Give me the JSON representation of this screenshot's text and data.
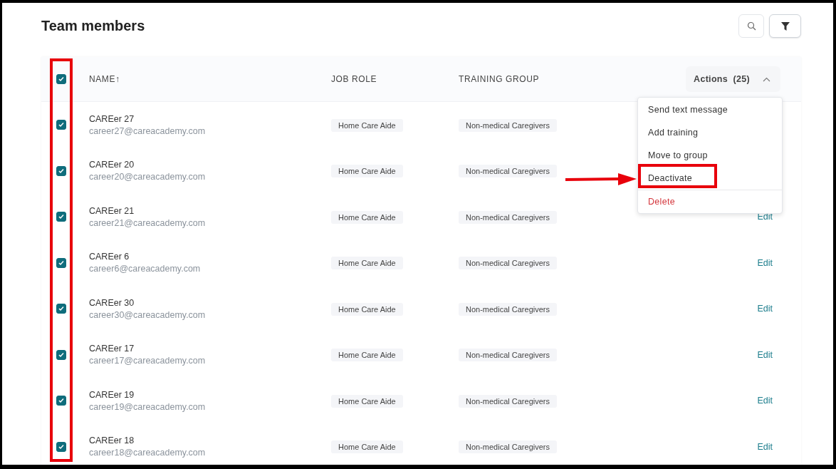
{
  "title": "Team members",
  "table": {
    "select_all": {
      "checked": true
    },
    "columns": [
      "NAME↑",
      "JOB ROLE",
      "TRAINING GROUP"
    ],
    "actions_button": {
      "label": "Actions",
      "count": "(25)",
      "expanded": true
    },
    "rows": [
      {
        "checked": true,
        "name": "CAREer 27",
        "email": "career27@careacademy.com",
        "job_role": "Home Care Aide",
        "training_group": "Non-medical Caregivers"
      },
      {
        "checked": true,
        "name": "CAREer 20",
        "email": "career20@careacademy.com",
        "job_role": "Home Care Aide",
        "training_group": "Non-medical Caregivers"
      },
      {
        "checked": true,
        "name": "CAREer 21",
        "email": "career21@careacademy.com",
        "job_role": "Home Care Aide",
        "training_group": "Non-medical Caregivers",
        "edit": "Edit"
      },
      {
        "checked": true,
        "name": "CAREer 6",
        "email": "career6@careacademy.com",
        "job_role": "Home Care Aide",
        "training_group": "Non-medical Caregivers",
        "edit": "Edit"
      },
      {
        "checked": true,
        "name": "CAREer 30",
        "email": "career30@careacademy.com",
        "job_role": "Home Care Aide",
        "training_group": "Non-medical Caregivers",
        "edit": "Edit"
      },
      {
        "checked": true,
        "name": "CAREer 17",
        "email": "career17@careacademy.com",
        "job_role": "Home Care Aide",
        "training_group": "Non-medical Caregivers",
        "edit": "Edit"
      },
      {
        "checked": true,
        "name": "CAREer 19",
        "email": "career19@careacademy.com",
        "job_role": "Home Care Aide",
        "training_group": "Non-medical Caregivers",
        "edit": "Edit"
      },
      {
        "checked": true,
        "name": "CAREer 18",
        "email": "career18@careacademy.com",
        "job_role": "Home Care Aide",
        "training_group": "Non-medical Caregivers",
        "edit": "Edit"
      }
    ]
  },
  "actions_menu": [
    {
      "label": "Send text message",
      "kind": "normal",
      "annotated": false
    },
    {
      "label": "Add training",
      "kind": "normal",
      "annotated": false
    },
    {
      "label": "Move to group",
      "kind": "normal",
      "annotated": false
    },
    {
      "label": "Deactivate",
      "kind": "normal",
      "annotated": true
    },
    {
      "label": "Delete",
      "kind": "danger",
      "annotated": false
    }
  ]
}
